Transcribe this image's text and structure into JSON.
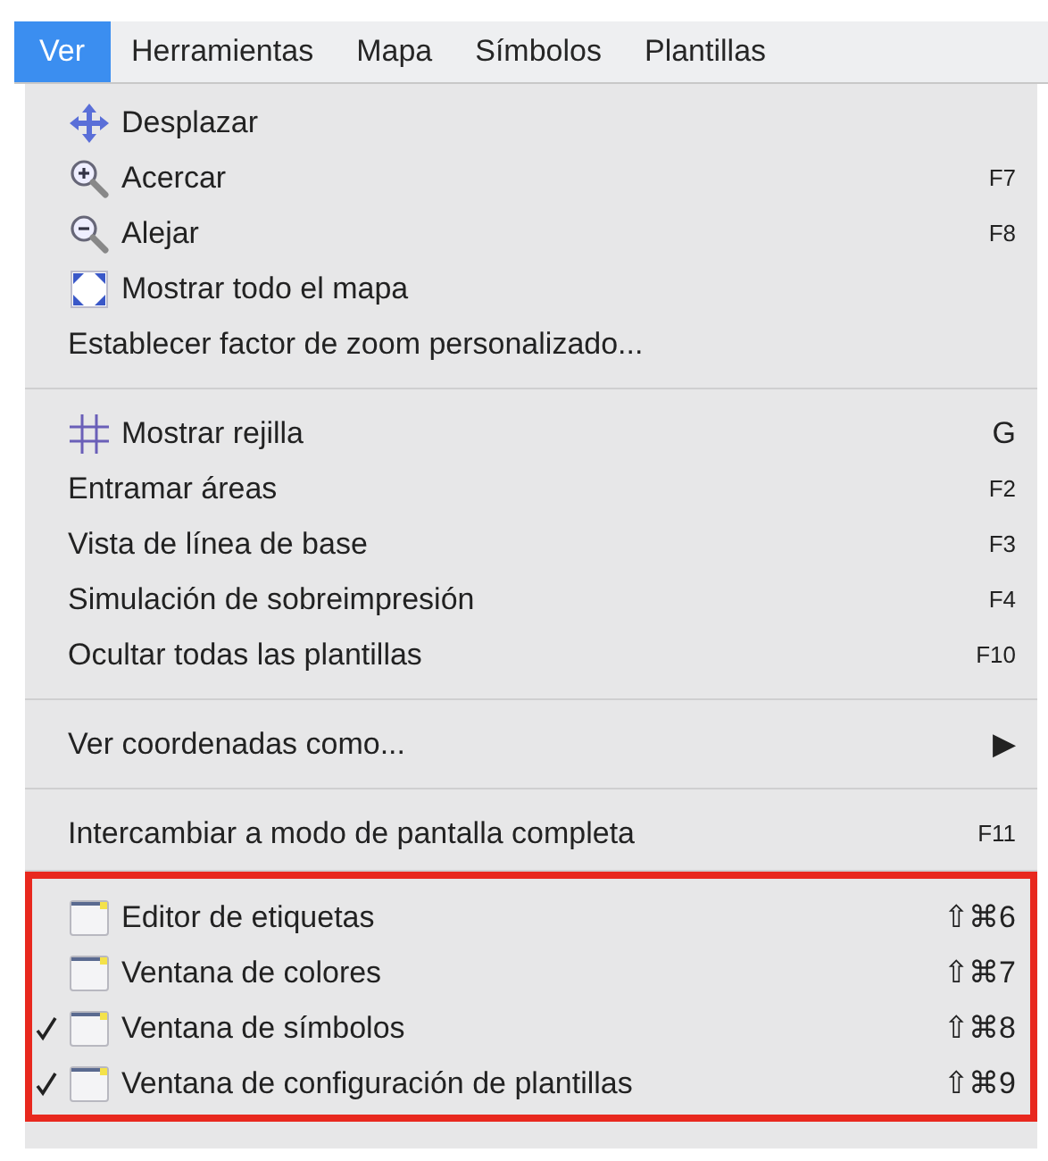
{
  "menubar": [
    {
      "label": "Ver",
      "selected": true
    },
    {
      "label": "Herramientas",
      "selected": false
    },
    {
      "label": "Mapa",
      "selected": false
    },
    {
      "label": "Símbolos",
      "selected": false
    },
    {
      "label": "Plantillas",
      "selected": false
    }
  ],
  "menu": {
    "sections": [
      {
        "highlighted": false,
        "items": [
          {
            "label": "Desplazar",
            "kind": "pan"
          },
          {
            "label": "Acercar",
            "kind": "zoomin",
            "shortcut": "F7"
          },
          {
            "label": "Alejar",
            "kind": "zoomout",
            "shortcut": "F8"
          },
          {
            "label": "Mostrar todo el mapa",
            "kind": "fit"
          },
          {
            "label": "Establecer factor de zoom personalizado..."
          }
        ]
      },
      {
        "highlighted": false,
        "items": [
          {
            "label": "Mostrar rejilla",
            "kind": "grid",
            "shortcut": "G"
          },
          {
            "label": "Entramar áreas",
            "shortcut": "F2"
          },
          {
            "label": "Vista de línea de base",
            "shortcut": "F3"
          },
          {
            "label": "Simulación de sobreimpresión",
            "shortcut": "F4"
          },
          {
            "label": "Ocultar todas las plantillas",
            "shortcut": "F10"
          }
        ]
      },
      {
        "highlighted": false,
        "items": [
          {
            "label": "Ver coordenadas como...",
            "shortcut": "▶"
          }
        ]
      },
      {
        "highlighted": false,
        "items": [
          {
            "label": "Intercambiar a modo de pantalla completa",
            "shortcut": "F11"
          }
        ]
      },
      {
        "highlighted": true,
        "items": [
          {
            "label": "Editor de etiquetas",
            "kind": "window",
            "shortcut": "⇧⌘6",
            "checked": false
          },
          {
            "label": "Ventana de colores",
            "kind": "window",
            "shortcut": "⇧⌘7",
            "checked": false
          },
          {
            "label": "Ventana de símbolos",
            "kind": "window",
            "shortcut": "⇧⌘8",
            "checked": true
          },
          {
            "label": "Ventana de configuración de plantillas",
            "kind": "window",
            "shortcut": "⇧⌘9",
            "checked": true
          }
        ]
      }
    ]
  }
}
